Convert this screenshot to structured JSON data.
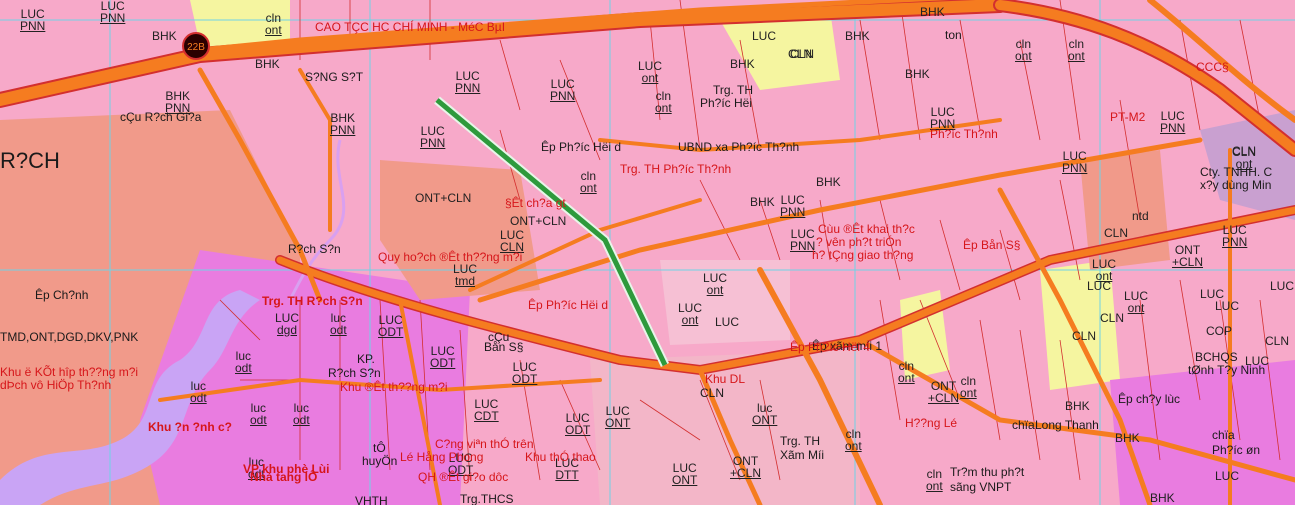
{
  "colors": {
    "residential": "#f7a9c9",
    "urban": "#e97ce0",
    "rice": "#f5f5a0",
    "perennial": "#f6c0d4",
    "forest_bhk": "#f3b6c8",
    "road": "#f57c20",
    "road_edge": "#d32f2f",
    "river": "#c9a4f5",
    "grid": "#6fd3e6",
    "salmon": "#f19a8a",
    "highlight": "#2e9a3c"
  },
  "route_badge": "22B",
  "zones": [
    {
      "code": "LUC",
      "sub": "PNN"
    },
    {
      "code": "LUC",
      "sub": "PNN"
    },
    {
      "code": "cln",
      "sub": "ont"
    },
    {
      "code": "BHK",
      "sub": ""
    },
    {
      "code": "BHK",
      "sub": ""
    },
    {
      "code": "BHK",
      "sub": "PNN"
    },
    {
      "code": "BHK",
      "sub": "PNN"
    },
    {
      "code": "LUC",
      "sub": "PNN"
    },
    {
      "code": "LUC",
      "sub": "PNN"
    },
    {
      "code": "LUC",
      "sub": "PNN"
    },
    {
      "code": "LUC",
      "sub": "ont"
    },
    {
      "code": "cln",
      "sub": "ont"
    },
    {
      "code": "BHK",
      "sub": ""
    },
    {
      "code": "LUC",
      "sub": ""
    },
    {
      "code": "CLN",
      "sub": ""
    },
    {
      "code": "BHK",
      "sub": ""
    },
    {
      "code": "BHK",
      "sub": ""
    },
    {
      "code": "BHK",
      "sub": ""
    },
    {
      "code": "LUC",
      "sub": "PNN"
    },
    {
      "code": "ONT+CLN",
      "sub": ""
    },
    {
      "code": "cln",
      "sub": "ont"
    },
    {
      "code": "ONT+CLN",
      "sub": ""
    },
    {
      "code": "LUC",
      "sub": "CLN"
    },
    {
      "code": "LUC",
      "sub": "tmd"
    },
    {
      "code": "LUC",
      "sub": "dgd"
    },
    {
      "code": "luc",
      "sub": "odt"
    },
    {
      "code": "luc",
      "sub": "odt"
    },
    {
      "code": "LUC",
      "sub": "ODT"
    },
    {
      "code": "LUC",
      "sub": "ODT"
    },
    {
      "code": "LUC",
      "sub": "ODT"
    },
    {
      "code": "luc",
      "sub": "odt"
    },
    {
      "code": "luc",
      "sub": "odt"
    },
    {
      "code": "luc",
      "sub": "odt"
    },
    {
      "code": "LUC",
      "sub": "CDT"
    },
    {
      "code": "LUC",
      "sub": "ODT"
    },
    {
      "code": "LUC",
      "sub": "ONT"
    },
    {
      "code": "luc",
      "sub": "ONT"
    },
    {
      "code": "LUC",
      "sub": "ONT"
    },
    {
      "code": "ONT",
      "sub": "+CLN"
    },
    {
      "code": "LUC",
      "sub": "DTT"
    },
    {
      "code": "LUC",
      "sub": "ont"
    },
    {
      "code": "LUC",
      "sub": ""
    },
    {
      "code": "LUC",
      "sub": "ont"
    },
    {
      "code": "LUC",
      "sub": "PNN"
    },
    {
      "code": "LUC",
      "sub": "PNN"
    },
    {
      "code": "LUC",
      "sub": "PNN"
    },
    {
      "code": "CLN",
      "sub": ""
    },
    {
      "code": "ONT",
      "sub": "+CLN"
    },
    {
      "code": "LUC",
      "sub": "ont"
    },
    {
      "code": "cln",
      "sub": "ont"
    },
    {
      "code": "cln",
      "sub": "ont"
    },
    {
      "code": "BHK",
      "sub": ""
    },
    {
      "code": "BHK",
      "sub": ""
    },
    {
      "code": "LUC",
      "sub": "PNN"
    },
    {
      "code": "LUC",
      "sub": "PNN"
    },
    {
      "code": "CLN",
      "sub": ""
    },
    {
      "code": "ntd",
      "sub": ""
    },
    {
      "code": "CLN",
      "sub": ""
    },
    {
      "code": "LUC",
      "sub": ""
    },
    {
      "code": "CLN",
      "sub": ""
    },
    {
      "code": "COP",
      "sub": ""
    },
    {
      "code": "BHK",
      "sub": ""
    },
    {
      "code": "LUC",
      "sub": ""
    },
    {
      "code": "BHK",
      "sub": ""
    },
    {
      "code": "CLN",
      "sub": ""
    },
    {
      "code": "LUC",
      "sub": "ont"
    },
    {
      "code": "CLN",
      "sub": "ont"
    },
    {
      "code": "cln",
      "sub": "ont"
    },
    {
      "code": "cln",
      "sub": "ont"
    },
    {
      "code": "ONT",
      "sub": "+CLN"
    },
    {
      "code": "BHK",
      "sub": ""
    },
    {
      "code": "LUC",
      "sub": ""
    },
    {
      "code": "CLN",
      "sub": ""
    },
    {
      "code": "LUC",
      "sub": ""
    },
    {
      "code": "LUC",
      "sub": ""
    },
    {
      "code": "cln",
      "sub": "ont"
    },
    {
      "code": "cln",
      "sub": "ont"
    },
    {
      "code": "luc",
      "sub": "odt"
    },
    {
      "code": "LUC",
      "sub": "ODT"
    },
    {
      "code": "LUC",
      "sub": ""
    }
  ],
  "places": [
    "cÇu R?ch Gi?a",
    "R?CH",
    "Êp Ch?nh",
    "TMD,ONT,DGD,DKV,PNK",
    "Êp Ph?íc Hëi d",
    "R?ch S?n",
    "cÇu",
    "Bån S§",
    "KP.",
    "R?ch S?n",
    "Trg. TH",
    "Ph?íc Hëi",
    "UBND xa Ph?íc Th?nh",
    "Trg. TH",
    "Xãm Míi",
    "Êp xãm míi 1",
    "CLN",
    "Tr?m thu ph?t",
    "sãng VNPT",
    "chïa",
    "Long Thanh",
    "Êp ch?y lùc",
    "chïa",
    "Ph?íc øn",
    "Cty. TNHH. C",
    "x?y dùng Min",
    "BCHQS",
    "tØnh T?y Ninh",
    "Trg.THCS",
    "VHTH",
    "huyÖn",
    "tÔ",
    "S?NG S?T",
    "ton"
  ],
  "red_labels": [
    "CAO TÇC HC CHÍ MINH - MéC BµI",
    "Quy ho?ch ®Êt th??ng m?i",
    "Êp Ph?íc Hëi d",
    "Trg. TH R?ch S?n",
    "Khu ®Êt th??ng m?i",
    "Khu ë KÕt hîp th??ng m?i",
    "dÞch vô HiÖp Th?nh",
    "Khu ?n ?nh c?",
    "VP khu phè Lùi",
    "Nhà tang lÔ",
    "C?ng viªn thÓ trên",
    "Khu thÓ thao",
    "QH ®Êt gi?o dôc",
    "§Êt ch?a gt",
    "Trg. TH Ph?íc Th?nh",
    "Cùu ®Êt khai th?c",
    "? vên ph?t triÓn",
    "h? tÇng giao th?ng",
    "Êp Bån S§",
    "Ph?íc Th?nh",
    "Khu DL",
    "Êp Ph?íc Hëi 4",
    "H??ng Lé",
    "Lé Hång Phong",
    "PT-M2",
    "CCC§"
  ]
}
